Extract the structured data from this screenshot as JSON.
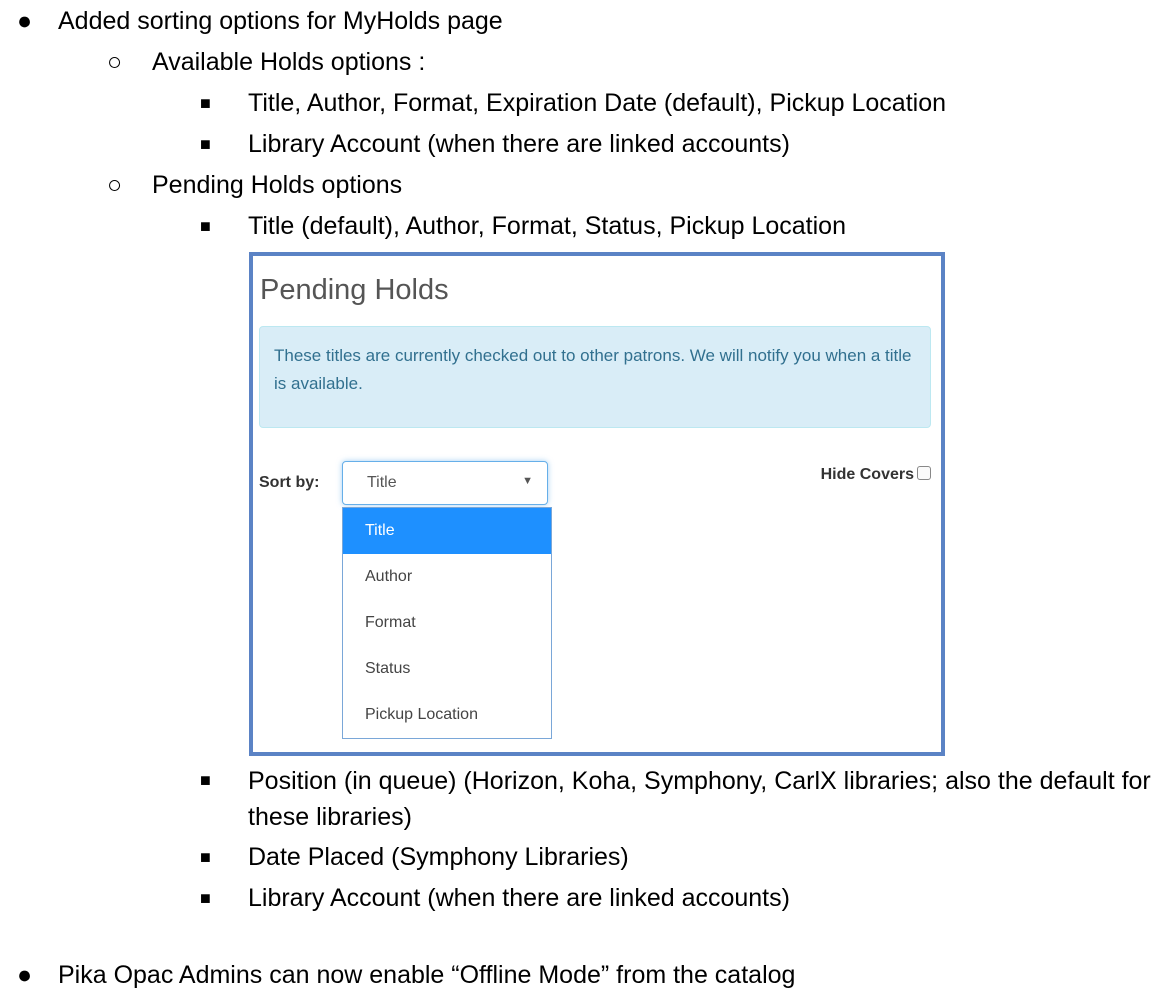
{
  "doc": {
    "item1": "Added sorting options for MyHolds page",
    "available_heading": "Available Holds options :",
    "available_items": [
      "Title, Author, Format, Expiration Date (default), Pickup Location",
      "Library Account (when there are linked accounts)"
    ],
    "pending_heading": "Pending Holds options",
    "pending_items": [
      "Title (default), Author, Format, Status, Pickup Location",
      "Position (in queue) (Horizon, Koha, Symphony, CarlX libraries; also the default for these libraries)",
      "Date Placed (Symphony Libraries)",
      "Library Account (when there are linked accounts)"
    ],
    "item2": "Pika Opac Admins can now enable “Offline Mode” from the catalog"
  },
  "screenshot": {
    "title": "Pending Holds",
    "alert": "These titles are currently checked out to other patrons. We will notify you when a title is available.",
    "sort_label": "Sort by:",
    "selected": "Title",
    "options": [
      "Title",
      "Author",
      "Format",
      "Status",
      "Pickup Location"
    ],
    "hide_covers": "Hide Covers"
  },
  "bullets": {
    "disc": "●",
    "circle": "○",
    "square": "■",
    "caret": "▼"
  },
  "colors": {
    "frame_border": "#5b83c5",
    "alert_bg": "#d9edf7",
    "alert_text": "#31708f",
    "selected_option": "#1e90ff"
  }
}
